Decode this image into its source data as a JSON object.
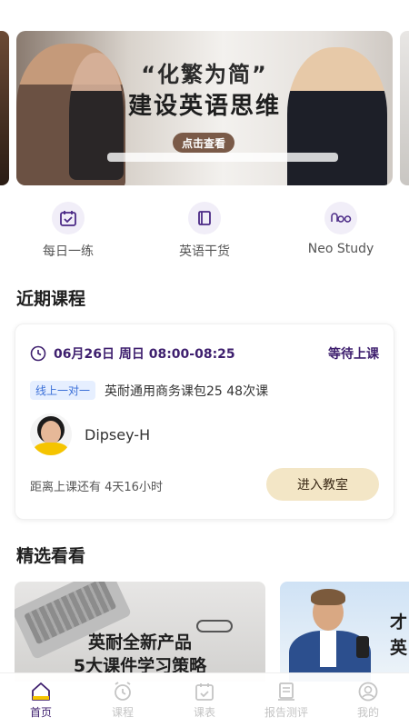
{
  "banner": {
    "title": "“化繁为简”",
    "subtitle": "建设英语思维",
    "button": "点击查看"
  },
  "quick_entries": [
    {
      "label": "每日一练",
      "icon": "calendar-check-icon"
    },
    {
      "label": "英语干货",
      "icon": "book-icon"
    },
    {
      "label": "Neo Study",
      "icon": "neo-logo-icon"
    }
  ],
  "sections": {
    "recent": "近期课程",
    "featured": "精选看看"
  },
  "course_card": {
    "time": "06月26日 周日 08:00-08:25",
    "status": "等待上课",
    "tag": "线上一对一",
    "course_name": "英耐通用商务课包25 48次课",
    "teacher": "Dipsey-H",
    "countdown": "距离上课还有 4天16小时",
    "enter_button": "进入教室"
  },
  "featured": [
    {
      "line1": "英耐全新产品",
      "line2": "5大课件学习策略"
    },
    {
      "line0": "才",
      "line1": "英"
    }
  ],
  "tabbar": [
    {
      "label": "首页",
      "icon": "home-icon",
      "active": true
    },
    {
      "label": "课程",
      "icon": "alarm-clock-icon",
      "active": false
    },
    {
      "label": "课表",
      "icon": "calendar-icon",
      "active": false
    },
    {
      "label": "报告测评",
      "icon": "report-icon",
      "active": false
    },
    {
      "label": "我的",
      "icon": "user-icon",
      "active": false
    }
  ],
  "colors": {
    "primary": "#3e1f6e",
    "accent_button": "#f3e6c6",
    "tag_bg": "#e6efff",
    "tag_text": "#3a6fd8"
  }
}
